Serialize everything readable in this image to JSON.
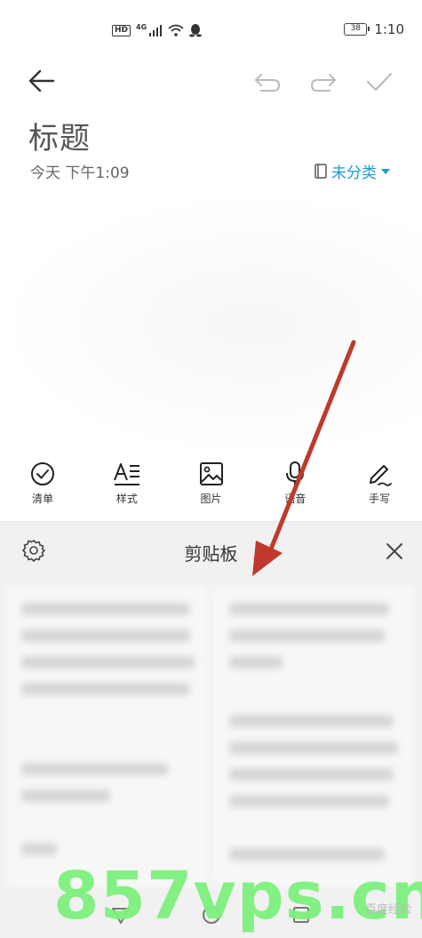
{
  "status_bar": {
    "hd": "HD",
    "network": "4G",
    "battery": "38",
    "time": "1:10"
  },
  "toolbar": {
    "icons": [
      "back-arrow-icon",
      "undo-icon",
      "redo-icon",
      "check-icon"
    ]
  },
  "note": {
    "title": "标题",
    "date": "今天 下午1:09",
    "category": "未分类",
    "accent_color": "#1a9bd6"
  },
  "format_bar": {
    "items": [
      {
        "label": "清单",
        "icon": "checklist-icon"
      },
      {
        "label": "样式",
        "icon": "text-style-icon"
      },
      {
        "label": "图片",
        "icon": "image-icon"
      },
      {
        "label": "语音",
        "icon": "microphone-icon"
      },
      {
        "label": "手写",
        "icon": "handwriting-icon"
      }
    ]
  },
  "clipboard": {
    "title": "剪贴板"
  },
  "overlay": {
    "watermark": "857vps.cn",
    "source_mark": "百度经验",
    "arrow_color": "#c0392b"
  }
}
